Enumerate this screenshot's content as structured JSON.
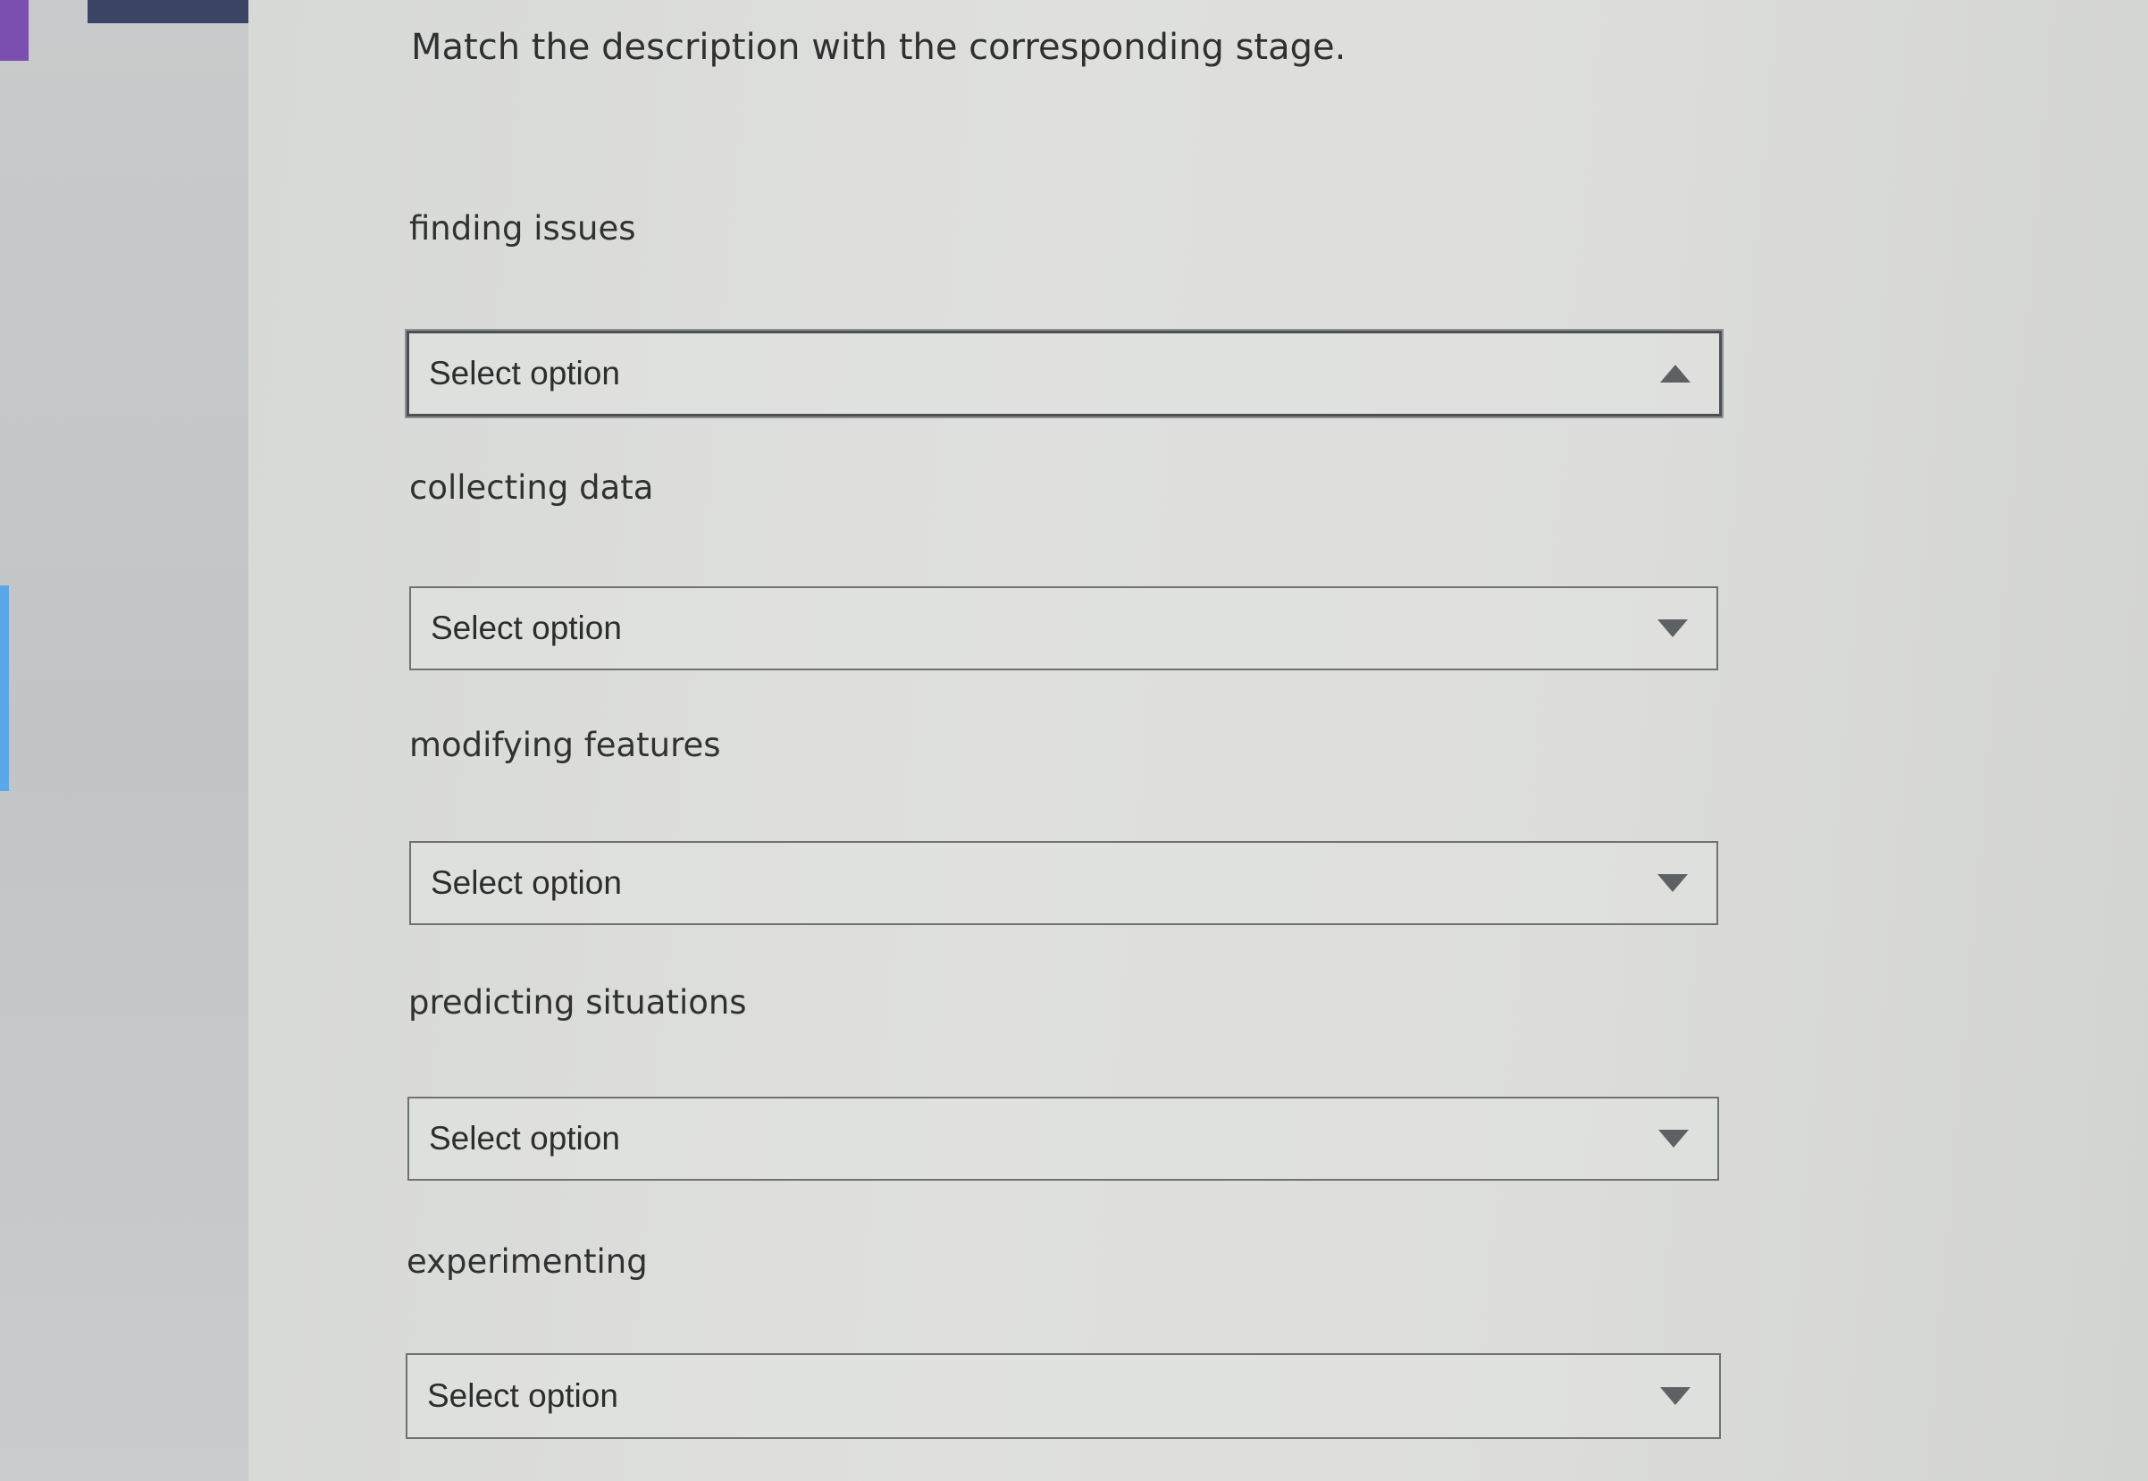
{
  "prompt": "Match the description with the corresponding stage.",
  "items": [
    {
      "label": "finding issues",
      "select": {
        "value": "Select option",
        "state": "open",
        "icon": "triangle-up-icon"
      }
    },
    {
      "label": "collecting data",
      "select": {
        "value": "Select option",
        "state": "closed",
        "icon": "triangle-down-icon"
      }
    },
    {
      "label": "modifying features",
      "select": {
        "value": "Select option",
        "state": "closed",
        "icon": "triangle-down-icon"
      }
    },
    {
      "label": "predicting situations",
      "select": {
        "value": "Select option",
        "state": "closed",
        "icon": "triangle-down-icon"
      }
    },
    {
      "label": "experimenting",
      "select": {
        "value": "Select option",
        "state": "closed",
        "icon": "triangle-down-icon"
      }
    }
  ],
  "colors": {
    "text": "#2f3131",
    "border": "#6f7272",
    "caret": "#5e6163",
    "accent_left": "#7a4fb0",
    "nav_block": "#3c4466"
  }
}
